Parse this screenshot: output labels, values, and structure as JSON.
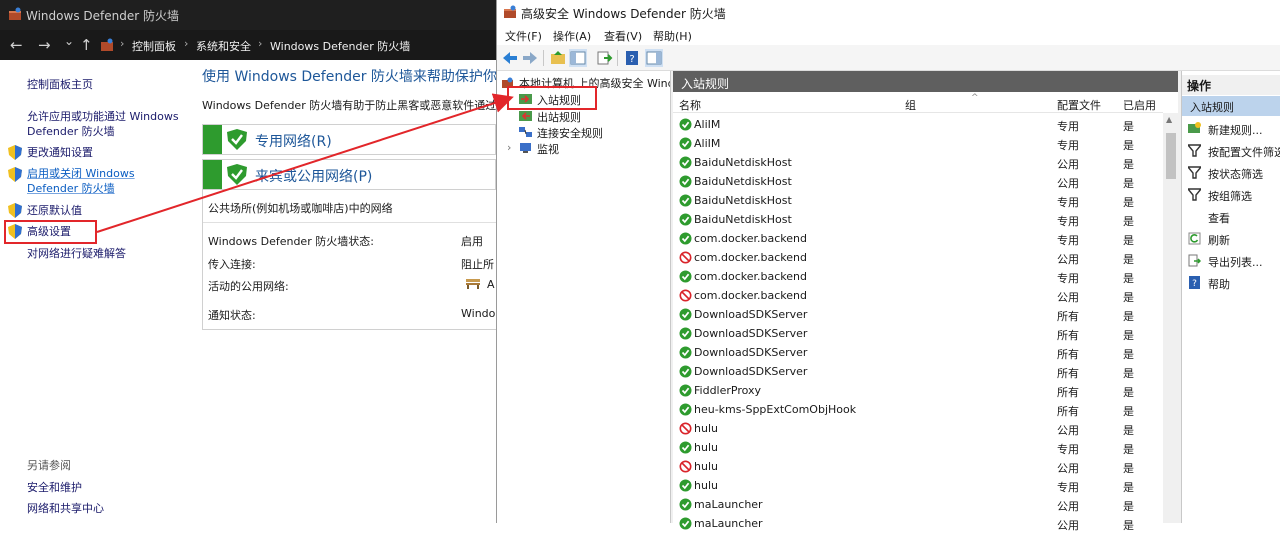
{
  "control_panel": {
    "title": "Windows Defender 防火墙",
    "nav": {
      "back": "←",
      "forward": "→",
      "dropdown": "⌄",
      "up": "↑"
    },
    "breadcrumb": [
      "控制面板",
      "系统和安全",
      "Windows Defender 防火墙"
    ],
    "breadcrumb_sep": "›",
    "sidebar": {
      "home": "控制面板主页",
      "allow_app_line1": "允许应用或功能通过 Windows",
      "allow_app_line2": "Defender 防火墙",
      "change_notify": "更改通知设置",
      "toggle_line1": "启用或关闭 Windows",
      "toggle_line2": "Defender 防火墙",
      "restore": "还原默认值",
      "advanced": "高级设置",
      "troubleshoot": "对网络进行疑难解答"
    },
    "see_also": {
      "heading": "另请参阅",
      "security": "安全和维护",
      "network": "网络和共享中心"
    },
    "main": {
      "heading": "使用 Windows Defender 防火墙来帮助保护你",
      "desc": "Windows Defender 防火墙有助于防止黑客或恶意软件通过",
      "private_network": "专用网络(R)",
      "public_network": "来宾或公用网络(P)",
      "public_desc": "公共场所(例如机场或咖啡店)中的网络",
      "status_label": "Windows Defender 防火墙状态:",
      "status_value": "启用",
      "incoming_label": "传入连接:",
      "incoming_value": "阻止所",
      "active_label": "活动的公用网络:",
      "active_value": "A",
      "notify_label": "通知状态:",
      "notify_value": "Windo"
    }
  },
  "mmc": {
    "title": "高级安全 Windows Defender 防火墙",
    "menu": [
      "文件(F)",
      "操作(A)",
      "查看(V)",
      "帮助(H)"
    ],
    "tree": {
      "root": "本地计算机 上的高级安全 Windo",
      "inbound": "入站规则",
      "outbound": "出站规则",
      "connection": "连接安全规则",
      "monitor": "监视",
      "expander": "›"
    },
    "list": {
      "header": "入站规则",
      "columns": {
        "name": "名称",
        "group": "组",
        "profile": "配置文件",
        "enabled": "已启用"
      },
      "sort_caret": "^",
      "rows": [
        {
          "name": "AliIM",
          "profile": "专用",
          "enabled": "是",
          "status": "allow"
        },
        {
          "name": "AliIM",
          "profile": "专用",
          "enabled": "是",
          "status": "allow"
        },
        {
          "name": "BaiduNetdiskHost",
          "profile": "公用",
          "enabled": "是",
          "status": "allow"
        },
        {
          "name": "BaiduNetdiskHost",
          "profile": "公用",
          "enabled": "是",
          "status": "allow"
        },
        {
          "name": "BaiduNetdiskHost",
          "profile": "专用",
          "enabled": "是",
          "status": "allow"
        },
        {
          "name": "BaiduNetdiskHost",
          "profile": "专用",
          "enabled": "是",
          "status": "allow"
        },
        {
          "name": "com.docker.backend",
          "profile": "专用",
          "enabled": "是",
          "status": "allow"
        },
        {
          "name": "com.docker.backend",
          "profile": "公用",
          "enabled": "是",
          "status": "block"
        },
        {
          "name": "com.docker.backend",
          "profile": "专用",
          "enabled": "是",
          "status": "allow"
        },
        {
          "name": "com.docker.backend",
          "profile": "公用",
          "enabled": "是",
          "status": "block"
        },
        {
          "name": "DownloadSDKServer",
          "profile": "所有",
          "enabled": "是",
          "status": "allow"
        },
        {
          "name": "DownloadSDKServer",
          "profile": "所有",
          "enabled": "是",
          "status": "allow"
        },
        {
          "name": "DownloadSDKServer",
          "profile": "所有",
          "enabled": "是",
          "status": "allow"
        },
        {
          "name": "DownloadSDKServer",
          "profile": "所有",
          "enabled": "是",
          "status": "allow"
        },
        {
          "name": "FiddlerProxy",
          "profile": "所有",
          "enabled": "是",
          "status": "allow"
        },
        {
          "name": "heu-kms-SppExtComObjHook",
          "profile": "所有",
          "enabled": "是",
          "status": "allow"
        },
        {
          "name": "hulu",
          "profile": "公用",
          "enabled": "是",
          "status": "block"
        },
        {
          "name": "hulu",
          "profile": "专用",
          "enabled": "是",
          "status": "allow"
        },
        {
          "name": "hulu",
          "profile": "公用",
          "enabled": "是",
          "status": "block"
        },
        {
          "name": "hulu",
          "profile": "专用",
          "enabled": "是",
          "status": "allow"
        },
        {
          "name": "maLauncher",
          "profile": "公用",
          "enabled": "是",
          "status": "allow"
        },
        {
          "name": "maLauncher",
          "profile": "公用",
          "enabled": "是",
          "status": "allow"
        }
      ]
    },
    "actions": {
      "header": "操作",
      "section": "入站规则",
      "items": [
        "新建规则...",
        "按配置文件筛选",
        "按状态筛选",
        "按组筛选",
        "查看",
        "刷新",
        "导出列表...",
        "帮助"
      ]
    }
  },
  "colors": {
    "annotation_red": "#e2262a",
    "allow_green": "#2e9b2e",
    "block_red": "#d9242a",
    "link_blue": "#0a5dc2"
  }
}
